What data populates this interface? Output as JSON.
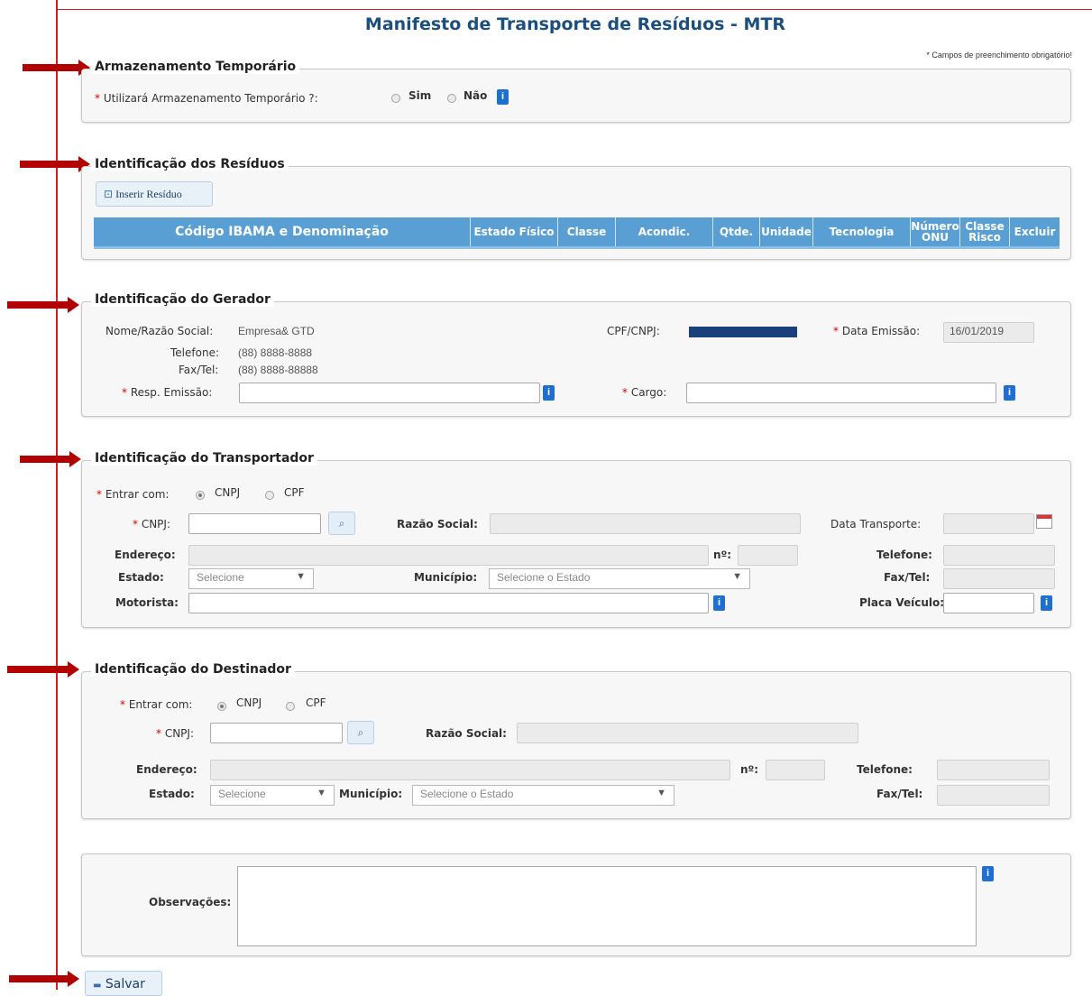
{
  "page": {
    "title": "Manifesto de Transporte de Resíduos - MTR",
    "required_note": "* Campos de preenchimento obrigatório!"
  },
  "armazenamento": {
    "legend": "Armazenamento Temporário",
    "question": "Utilizará Armazenamento Temporário ?:",
    "options": [
      "Sim",
      "Não"
    ]
  },
  "residuos": {
    "legend": "Identificação dos Resíduos",
    "insert_button": "Inserir Resíduo",
    "columns": [
      "Código IBAMA e Denominação",
      "Estado Físico",
      "Classe",
      "Acondic.",
      "Qtde.",
      "Unidade",
      "Tecnologia",
      "Número ONU",
      "Classe Risco",
      "Excluir"
    ]
  },
  "gerador": {
    "legend": "Identificação do Gerador",
    "nome_label": "Nome/Razão Social:",
    "nome_value": "Empresa& GTD",
    "telefone_label": "Telefone:",
    "telefone_value": "(88) 8888-8888",
    "fax_label": "Fax/Tel:",
    "fax_value": "(88) 8888-88888",
    "cpf_label": "CPF/CNPJ:",
    "data_emissao_label": "Data Emissão:",
    "data_emissao_value": "16/01/2019",
    "resp_label": "Resp. Emissão:",
    "cargo_label": "Cargo:"
  },
  "transportador": {
    "legend": "Identificação do Transportador",
    "entrar_label": "Entrar com:",
    "entrar_options": [
      "CNPJ",
      "CPF"
    ],
    "cnpj_label": "CNPJ:",
    "razao_label": "Razão Social:",
    "data_transporte_label": "Data Transporte:",
    "endereco_label": "Endereço:",
    "numero_label": "nº:",
    "telefone_label": "Telefone:",
    "estado_label": "Estado:",
    "estado_value": "Selecione",
    "municipio_label": "Município:",
    "municipio_value": "Selecione o Estado",
    "fax_label": "Fax/Tel:",
    "motorista_label": "Motorista:",
    "placa_label": "Placa Veículo:"
  },
  "destinador": {
    "legend": "Identificação do Destinador",
    "entrar_label": "Entrar com:",
    "entrar_options": [
      "CNPJ",
      "CPF"
    ],
    "cnpj_label": "CNPJ:",
    "razao_label": "Razão Social:",
    "endereco_label": "Endereço:",
    "numero_label": "nº:",
    "telefone_label": "Telefone:",
    "estado_label": "Estado:",
    "estado_value": "Selecione",
    "municipio_label": "Município:",
    "municipio_value": "Selecione o Estado",
    "fax_label": "Fax/Tel:"
  },
  "observacoes": {
    "label": "Observações:"
  },
  "actions": {
    "save_label": "Salvar"
  },
  "colors": {
    "accent": "#1d4f7e",
    "table_header": "#5a9fd4",
    "arrow": "#b20000",
    "required": "#dd0000"
  }
}
